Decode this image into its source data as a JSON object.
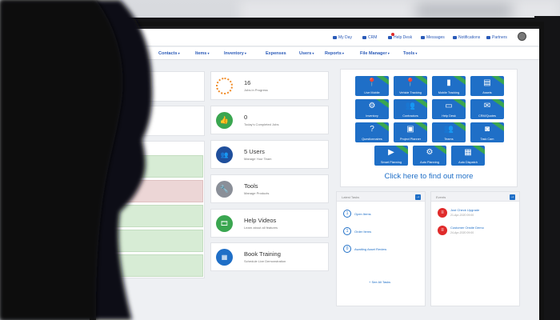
{
  "topbar": {
    "items": [
      {
        "label": "My Day",
        "icon": "calendar-icon"
      },
      {
        "label": "CRM",
        "icon": "chat-icon"
      },
      {
        "label": "Help Desk",
        "icon": "rocket-icon"
      },
      {
        "label": "Messages",
        "icon": "mail-icon"
      },
      {
        "label": "Notifications",
        "icon": "bell-icon"
      },
      {
        "label": "Partners",
        "icon": "people-icon"
      }
    ]
  },
  "nav": {
    "items": [
      "Contacts",
      "Items",
      "Inventory",
      "Expenses",
      "Users",
      "Reports",
      "File Manager",
      "Tools"
    ]
  },
  "stats": [
    {
      "title": "16",
      "subtitle": "Jobs in Progress",
      "icon": "spinner-icon",
      "color": "#f08a24"
    },
    {
      "title": "0",
      "subtitle": "Today's Completed Jobs",
      "icon": "thumbs-up-icon",
      "color": "#3aa650"
    },
    {
      "title": "5 Users",
      "subtitle": "Manage Your Team",
      "icon": "users-icon",
      "color": "#1f4f9c"
    },
    {
      "title": "Tools",
      "subtitle": "Manage Products",
      "icon": "wrench-icon",
      "color": "#8a8f98"
    },
    {
      "title": "Help Videos",
      "subtitle": "Learn about all features",
      "icon": "film-icon",
      "color": "#3aa650"
    },
    {
      "title": "Book Training",
      "subtitle": "Schedule Live Demonstration",
      "icon": "calendar-icon",
      "color": "#1f6fc7"
    }
  ],
  "tiles": [
    {
      "label": "Live Mobile",
      "glyph": "📍"
    },
    {
      "label": "Vehicle Tracking",
      "glyph": "📍"
    },
    {
      "label": "Mobile Tracking",
      "glyph": "▮"
    },
    {
      "label": "Assets",
      "glyph": "▤"
    },
    {
      "label": "Inventory",
      "glyph": "⚙"
    },
    {
      "label": "Contractors",
      "glyph": "👥"
    },
    {
      "label": "Help Desk",
      "glyph": "▭"
    },
    {
      "label": "CRM/Quotes",
      "glyph": "✉"
    },
    {
      "label": "Questionnaires",
      "glyph": "?"
    },
    {
      "label": "Project Planner",
      "glyph": "▣"
    },
    {
      "label": "Teams",
      "glyph": "👥"
    },
    {
      "label": "Task Cam",
      "glyph": "◙"
    },
    {
      "label": "Smart Planning",
      "glyph": "▶"
    },
    {
      "label": "Auto Planning",
      "glyph": "⚙"
    },
    {
      "label": "Auto Dispatch",
      "glyph": "▦"
    }
  ],
  "find_out_more": "Click here to find out more",
  "tasks_panel": {
    "title": "Latest Tasks",
    "items": [
      {
        "num": "1",
        "label": "Open Items"
      },
      {
        "num": "1",
        "label": "Order Items"
      },
      {
        "num": "0",
        "label": "Awaiting Asset Review"
      }
    ],
    "footer": "+ See All Tasks"
  },
  "events_panel": {
    "title": "Events",
    "items": [
      {
        "label": "Just Check Upgrade",
        "date": "21-Apr-2020 09:00"
      },
      {
        "label": "Customer Onsite Demo",
        "date": "24-Apr-2020 09:00"
      }
    ]
  }
}
